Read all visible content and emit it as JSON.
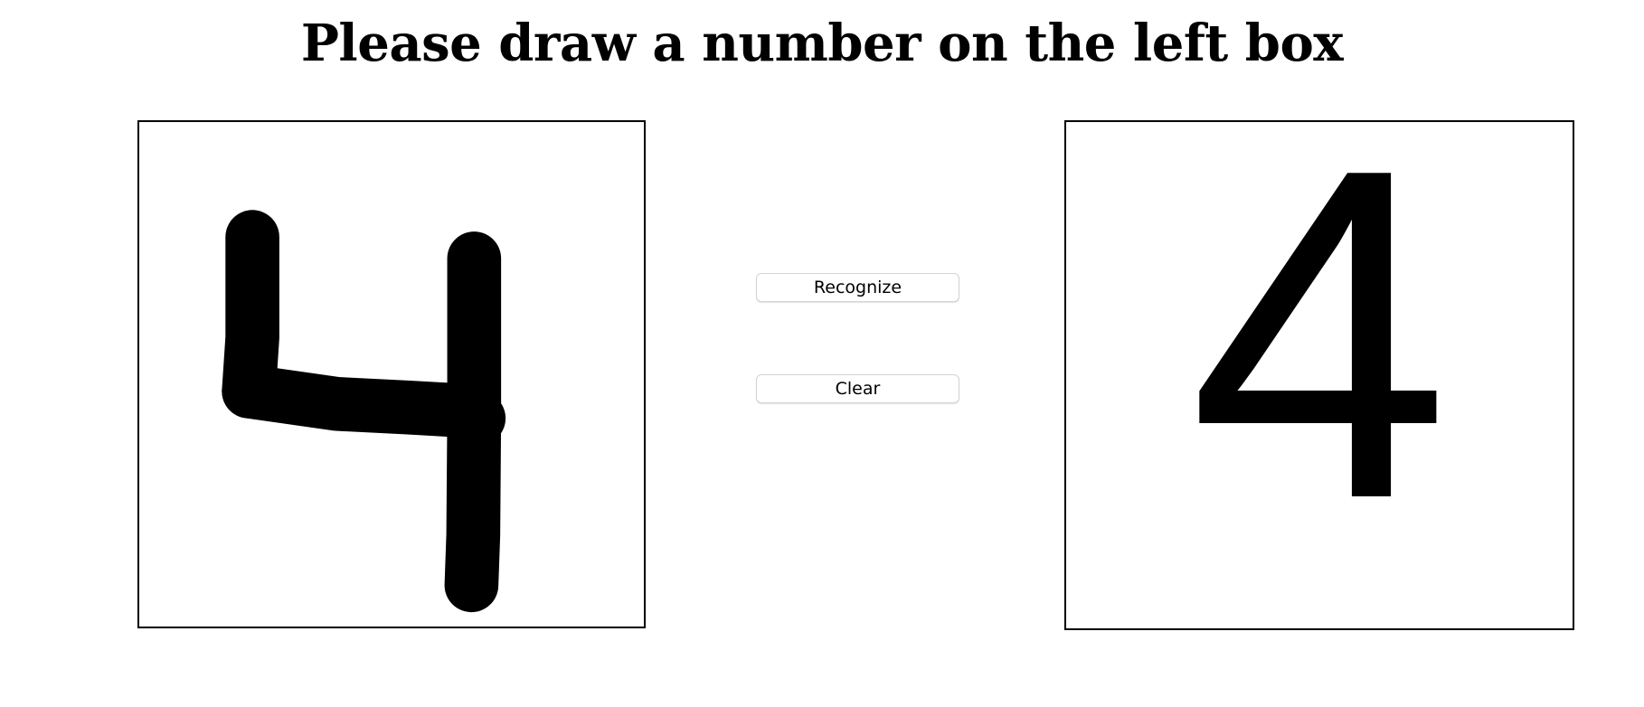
{
  "header": {
    "title": "Please draw a number on the left box"
  },
  "controls": {
    "recognize_label": "Recognize",
    "clear_label": "Clear"
  },
  "result": {
    "digit": "4"
  },
  "colors": {
    "ink": "#000000",
    "background": "#ffffff",
    "button_border": "#d4d4d4"
  }
}
